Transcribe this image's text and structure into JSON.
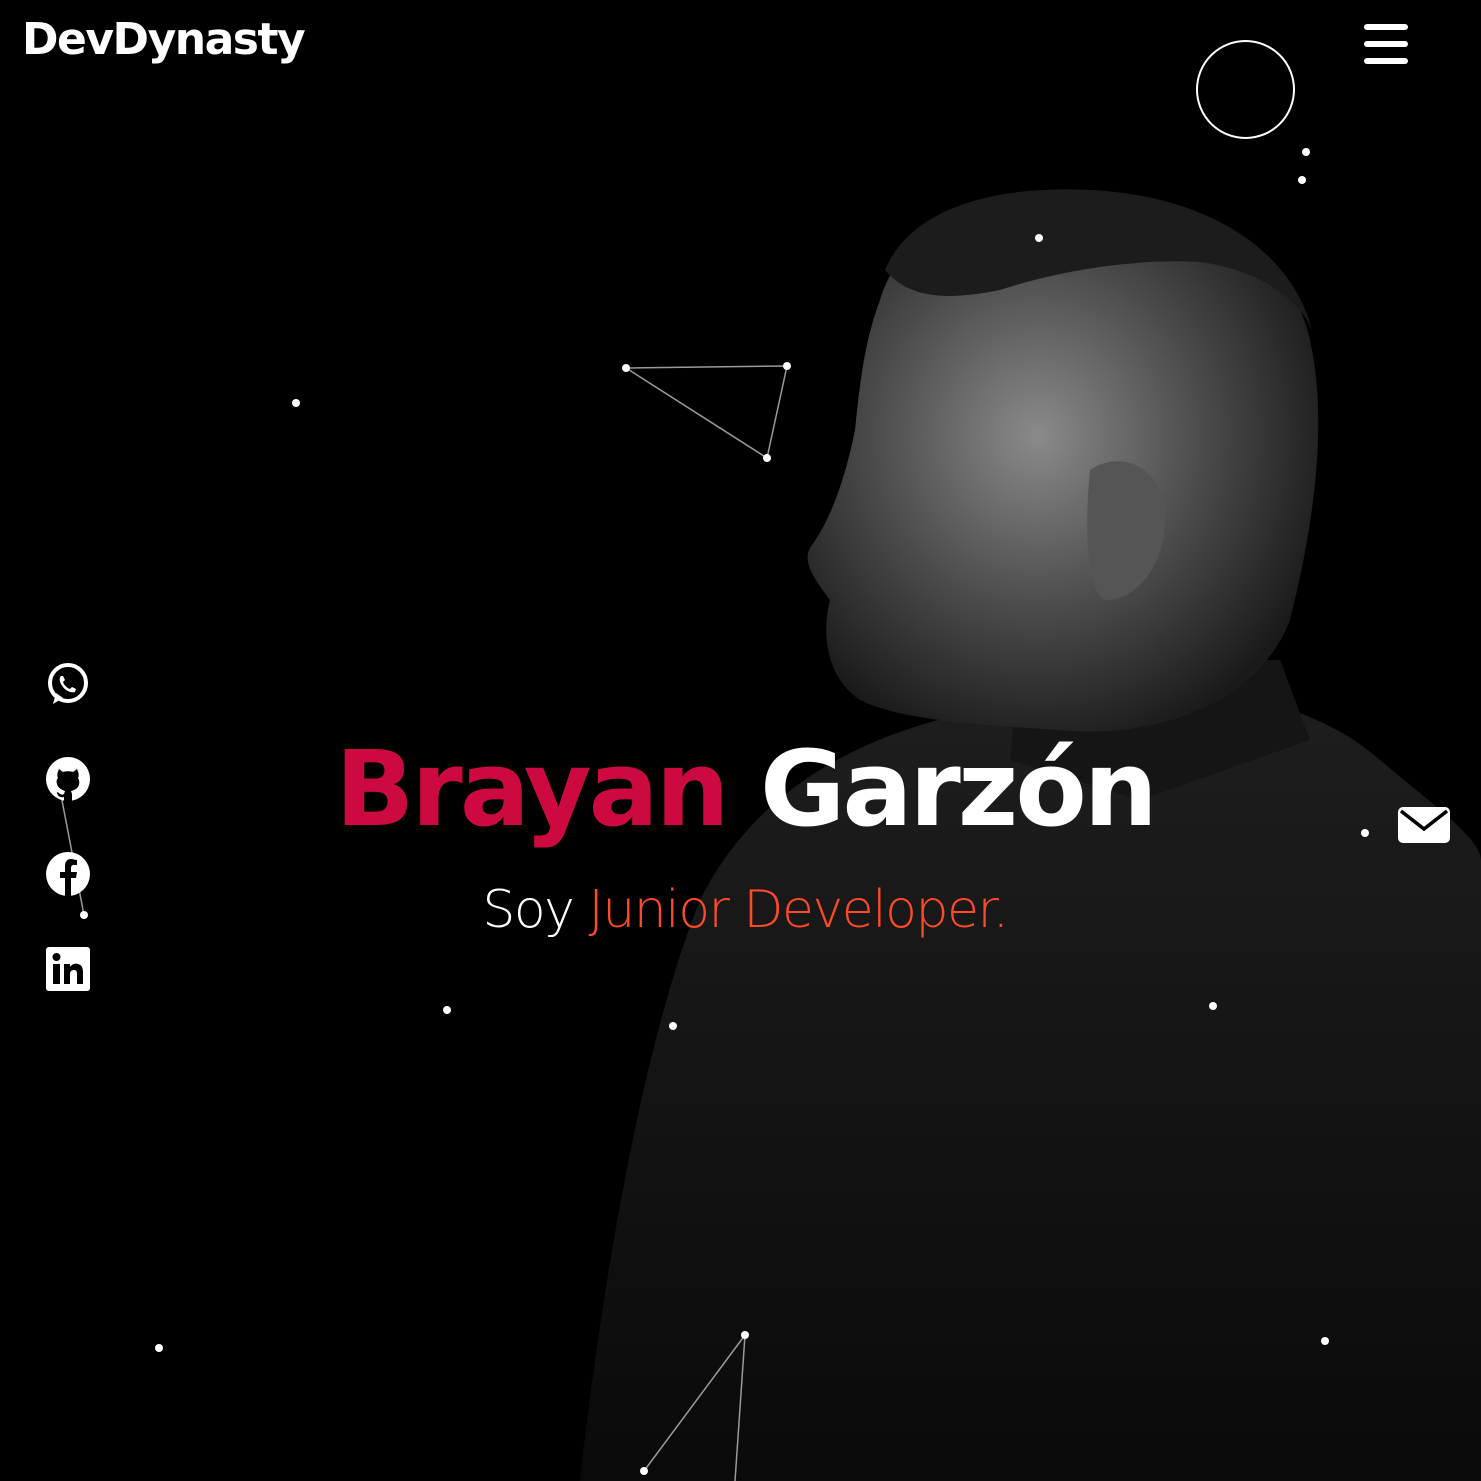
{
  "header": {
    "brand": "DevDynasty",
    "menu_icon": "hamburger-menu-icon"
  },
  "hero": {
    "first_name": "Brayan",
    "last_name": "Garzón",
    "role_prefix": "Soy",
    "role_title": "Junior Developer."
  },
  "social": [
    {
      "name": "WhatsApp",
      "icon": "whatsapp-icon"
    },
    {
      "name": "GitHub",
      "icon": "github-icon"
    },
    {
      "name": "Facebook",
      "icon": "facebook-icon"
    },
    {
      "name": "LinkedIn",
      "icon": "linkedin-icon"
    }
  ],
  "contact": {
    "icon": "mail-icon"
  },
  "colors": {
    "background": "#000000",
    "first_name": "#cc0a3f",
    "role_title": "#ff4a2a",
    "text": "#ffffff"
  }
}
